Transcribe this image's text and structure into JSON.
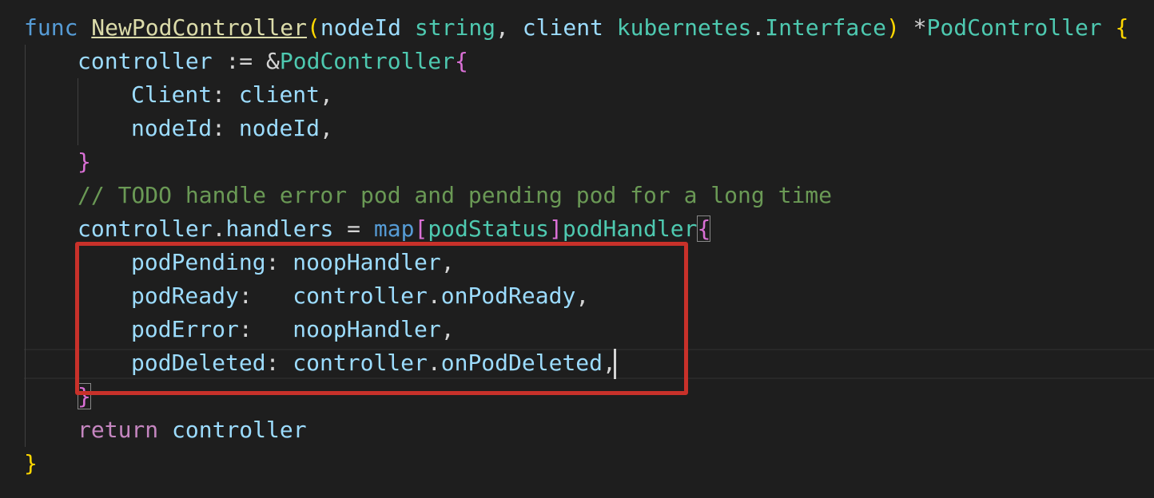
{
  "code": {
    "l1": {
      "kw": "func",
      "name": "NewPodController",
      "open_paren": "(",
      "p1": "nodeId",
      "p1_type": "string",
      "comma": ",",
      "p2": "client",
      "p2_pkg": "kubernetes",
      "dot": ".",
      "p2_type": "Interface",
      "close_paren": ")",
      "ret_ptr": "*",
      "ret_type": "PodController",
      "open_brace": "{"
    },
    "l2": {
      "var": "controller",
      "op": ":=",
      "amp": "&",
      "type": "PodController",
      "open_brace": "{"
    },
    "l3": {
      "field": "Client",
      "colon": ":",
      "value": "client",
      "comma": ","
    },
    "l4": {
      "field": "nodeId",
      "colon": ":",
      "value": "nodeId",
      "comma": ","
    },
    "l5": {
      "close_brace": "}"
    },
    "l6": {
      "comment": "// TODO handle error pod and pending pod for a long time"
    },
    "l7": {
      "obj": "controller",
      "dot": ".",
      "field": "handlers",
      "op": "=",
      "kw": "map",
      "lbr": "[",
      "key_type": "podStatus",
      "rbr": "]",
      "val_type": "podHandler",
      "open_brace": "{"
    },
    "l8": {
      "key": "podPending",
      "colon": ":",
      "value": "noopHandler",
      "comma": ","
    },
    "l9": {
      "key": "podReady",
      "colon": ":",
      "obj": "controller",
      "dot": ".",
      "method": "onPodReady",
      "comma": ","
    },
    "l10": {
      "key": "podError",
      "colon": ":",
      "value": "noopHandler",
      "comma": ","
    },
    "l11": {
      "key": "podDeleted",
      "colon": ":",
      "obj": "controller",
      "dot": ".",
      "method": "onPodDeleted",
      "comma": ","
    },
    "l12": {
      "close_brace": "}"
    },
    "l13": {
      "kw": "return",
      "value": "controller"
    },
    "l14": {
      "close_brace": "}"
    }
  },
  "colors": {
    "background": "#1e1e1e",
    "keyword": "#569cd6",
    "control_keyword": "#c586c0",
    "function": "#dcdcaa",
    "type": "#4ec9b0",
    "variable": "#9cdcfe",
    "comment": "#6a9955",
    "highlight_box": "#c8312a"
  }
}
